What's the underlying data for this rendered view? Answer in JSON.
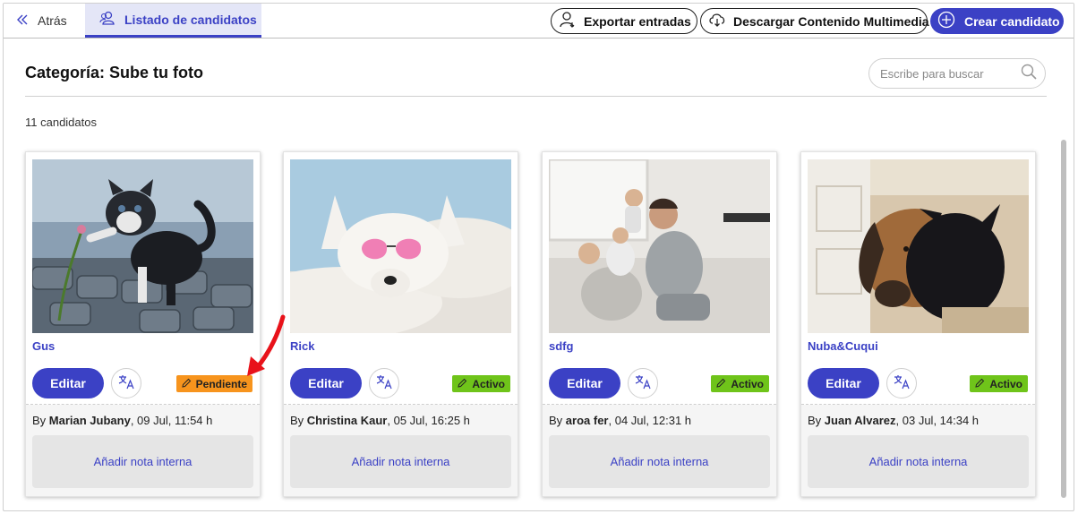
{
  "topbar": {
    "back_label": "Atrás",
    "active_tab_label": "Listado de candidatos",
    "export_label": "Exportar entradas",
    "download_label": "Descargar Contenido Multimedia",
    "create_label": "Crear candidato"
  },
  "header": {
    "title": "Categoría: Sube tu foto",
    "search_placeholder": "Escribe para buscar",
    "count_label": "11 candidatos"
  },
  "cards": [
    {
      "name": "Gus",
      "edit_label": "Editar",
      "status": "Pendiente",
      "status_color": "#f7941d",
      "by_prefix": "By",
      "author": "Marian Jubany",
      "date": ", 09 Jul, 11:54 h",
      "note_label": "Añadir nota interna",
      "photo_subject": "kitten"
    },
    {
      "name": "Rick",
      "edit_label": "Editar",
      "status": "Activo",
      "status_color": "#6fc41a",
      "by_prefix": "By",
      "author": "Christina Kaur",
      "date": ", 05 Jul, 16:25 h",
      "note_label": "Añadir nota interna",
      "photo_subject": "white-dog-heart-glasses"
    },
    {
      "name": "sdfg",
      "edit_label": "Editar",
      "status": "Activo",
      "status_color": "#6fc41a",
      "by_prefix": "By",
      "author": "aroa fer",
      "date": ", 04 Jul, 12:31 h",
      "note_label": "Añadir nota interna",
      "photo_subject": "family-on-sofa"
    },
    {
      "name": "Nuba&Cuqui",
      "edit_label": "Editar",
      "status": "Activo",
      "status_color": "#6fc41a",
      "by_prefix": "By",
      "author": "Juan Alvarez",
      "date": ", 03 Jul, 14:34 h",
      "note_label": "Añadir nota interna",
      "photo_subject": "two-dogs"
    }
  ],
  "colors": {
    "accent": "#3b41c5",
    "active_tab_bg": "#e4e6f7",
    "pending": "#f7941d",
    "active": "#6fc41a",
    "annotation_arrow": "#e8121a"
  },
  "icons": {
    "back": "chevrons-left-icon",
    "tab": "users-icon",
    "export": "user-download-icon",
    "download": "cloud-download-icon",
    "create": "plus-circle-icon",
    "search": "search-icon",
    "translate": "translate-icon",
    "status": "pencil-icon"
  }
}
